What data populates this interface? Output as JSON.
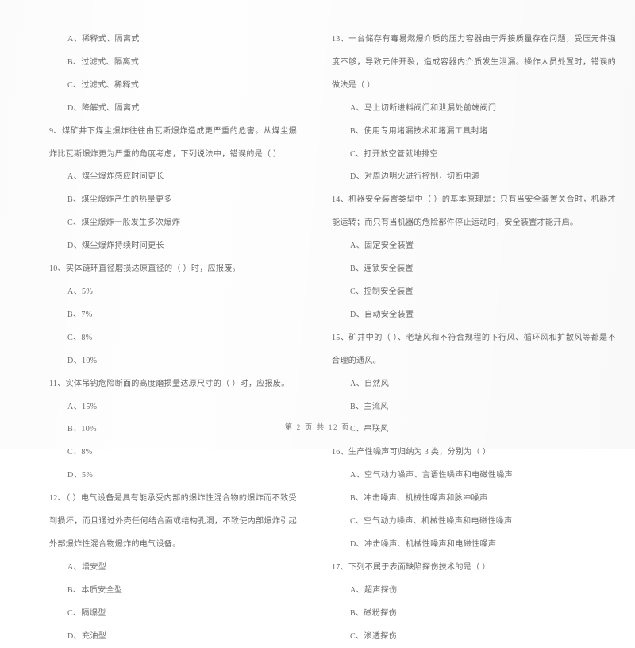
{
  "document": {
    "type": "exam-paper-scan",
    "footer": {
      "prefix": "第",
      "page_number": "2",
      "middle": "页  共",
      "total_pages": "12",
      "suffix": "页",
      "full_text": "第 2 页  共 12 页"
    }
  },
  "left_column": {
    "orphan_options": [
      "A、稀释式、隔离式",
      "B、过滤式、隔离式",
      "C、过滤式、稀释式",
      "D、降解式、隔离式"
    ],
    "questions": [
      {
        "number": "9",
        "stem": "9、煤矿井下煤尘爆炸往往由瓦斯爆炸造成更严重的危害。从煤尘爆炸比瓦斯爆炸更为严重的角度考虑，下列说法中，错误的是（     ）",
        "options": [
          "A、煤尘爆炸感应时间更长",
          "B、煤尘爆炸产生的热量更多",
          "C、煤尘爆炸一般发生多次爆炸",
          "D、煤尘爆炸持续时间更长"
        ]
      },
      {
        "number": "10",
        "stem": "10、实体链环直径磨损达原直径的（     ）时，应报废。",
        "options": [
          "A、5%",
          "B、7%",
          "C、8%",
          "D、10%"
        ]
      },
      {
        "number": "11",
        "stem": "11、实体吊钩危险断面的高度磨损量达原尺寸的（     ）时，应报废。",
        "options": [
          "A、15%",
          "B、10%",
          "C、8%",
          "D、5%"
        ]
      },
      {
        "number": "12",
        "stem": "12、（     ）电气设备是具有能承受内部的爆炸性混合物的爆炸而不致受到损坏，而且通过外壳任何结合面或结构孔洞，不致使内部爆炸引起外部爆炸性混合物爆炸的电气设备。",
        "options": [
          "A、增安型",
          "B、本质安全型",
          "C、隔爆型",
          "D、充油型"
        ]
      }
    ]
  },
  "right_column": {
    "questions": [
      {
        "number": "13",
        "stem": "13、一台储存有毒易燃爆介质的压力容器由于焊接质量存在问题，受压元件强度不够，导致元件开裂，造成容器内介质发生泄漏。操作人员处置时，错误的做法是（     ）",
        "options": [
          "A、马上切断进料阀门和泄漏处前端阀门",
          "B、使用专用堵漏技术和堵漏工具封堵",
          "C、打开放空管就地排空",
          "D、对周边明火进行控制，切断电源"
        ]
      },
      {
        "number": "14",
        "stem": "14、机器安全装置类型中（     ）的基本原理是：只有当安全装置关合时，机器才能运转；而只有当机器的危险部件停止运动时，安全装置才能开启。",
        "options": [
          "A、固定安全装置",
          "B、连锁安全装置",
          "C、控制安全装置",
          "D、自动安全装置"
        ]
      },
      {
        "number": "15",
        "stem": "15、矿井中的（     ）、老塘风和不符合规程的下行风、循环风和扩散风等都是不合理的通风。",
        "options": [
          "A、自然风",
          "B、主流风",
          "C、串联风"
        ]
      },
      {
        "number": "16",
        "stem": "16、生产性噪声可归纳为 3 类，分别为（     ）",
        "options": [
          "A、空气动力噪声、言语性噪声和电磁性噪声",
          "B、冲击噪声、机械性噪声和脉冲噪声",
          "C、空气动力噪声、机械性噪声和电磁性噪声",
          "D、冲击噪声、机械性噪声和电磁性噪声"
        ]
      },
      {
        "number": "17",
        "stem": "17、下列不属于表面缺陷探伤技术的是（     ）",
        "options": [
          "A、超声探伤",
          "B、磁粉探伤",
          "C、渗透探伤"
        ]
      }
    ]
  }
}
